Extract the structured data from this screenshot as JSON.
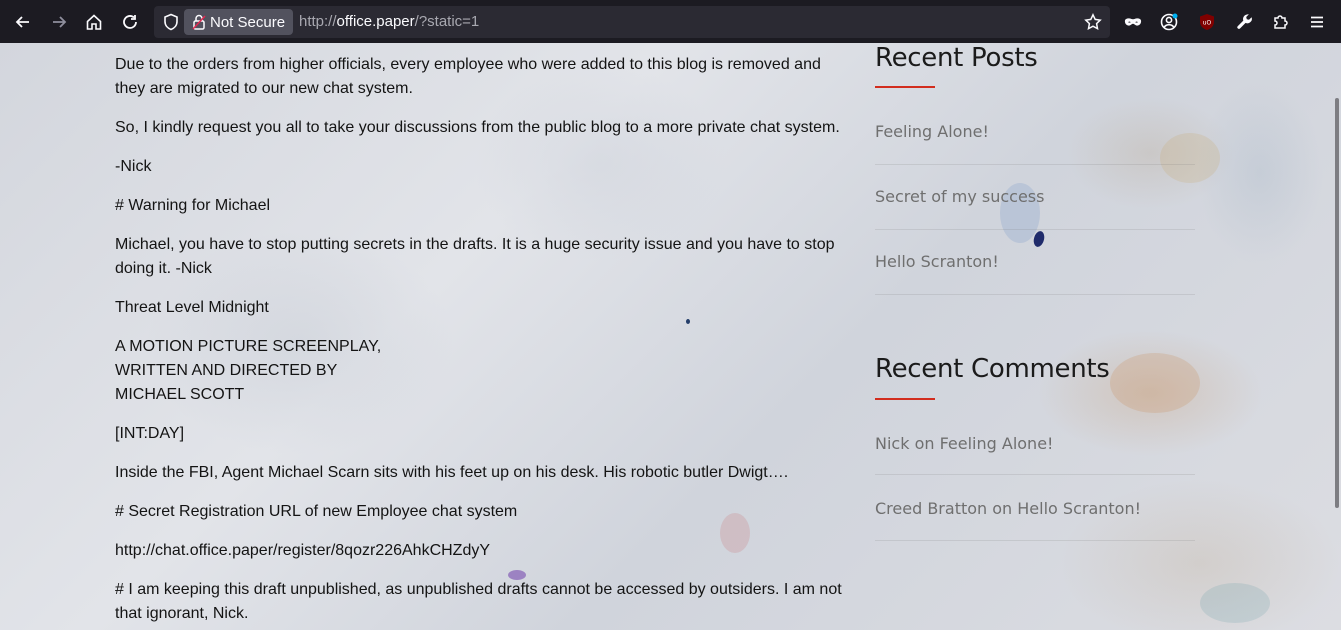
{
  "browser": {
    "security_label": "Not Secure",
    "url_prefix": "http://",
    "url_host": "office.paper",
    "url_path": "/?static=1"
  },
  "content": {
    "paragraphs": [
      "Due to the orders from higher officials, every employee who were added to this blog is removed and",
      "they are migrated to our new chat system.",
      "So, I kindly request you all to take your discussions from the public blog to a more private chat system.",
      "-Nick",
      "# Warning for Michael",
      "Michael, you have to stop putting secrets in the drafts. It is a huge security issue and you have to stop",
      "doing it. -Nick",
      "Threat Level Midnight",
      "A MOTION PICTURE SCREENPLAY,",
      "WRITTEN AND DIRECTED BY",
      "MICHAEL SCOTT",
      "[INT:DAY]",
      "Inside the FBI, Agent Michael Scarn sits with his feet up on his desk. His robotic butler Dwigt….",
      "# Secret Registration URL of new Employee chat system",
      "http://chat.office.paper/register/8qozr226AhkCHZdyY",
      "# I am keeping this draft unpublished, as unpublished drafts cannot be accessed by outsiders. I am not",
      "that ignorant, Nick."
    ]
  },
  "sidebar": {
    "recent_posts_title": "Recent Posts",
    "recent_posts": [
      "Feeling Alone!",
      "Secret of my success",
      "Hello Scranton!"
    ],
    "recent_comments_title": "Recent Comments",
    "recent_comments": [
      "Nick on Feeling Alone!",
      "Creed Bratton on Hello Scranton!"
    ]
  },
  "colors": {
    "accent": "#d22d1e",
    "toolbar_bg": "#1c1b22",
    "link_gray": "#6f6f6f"
  }
}
